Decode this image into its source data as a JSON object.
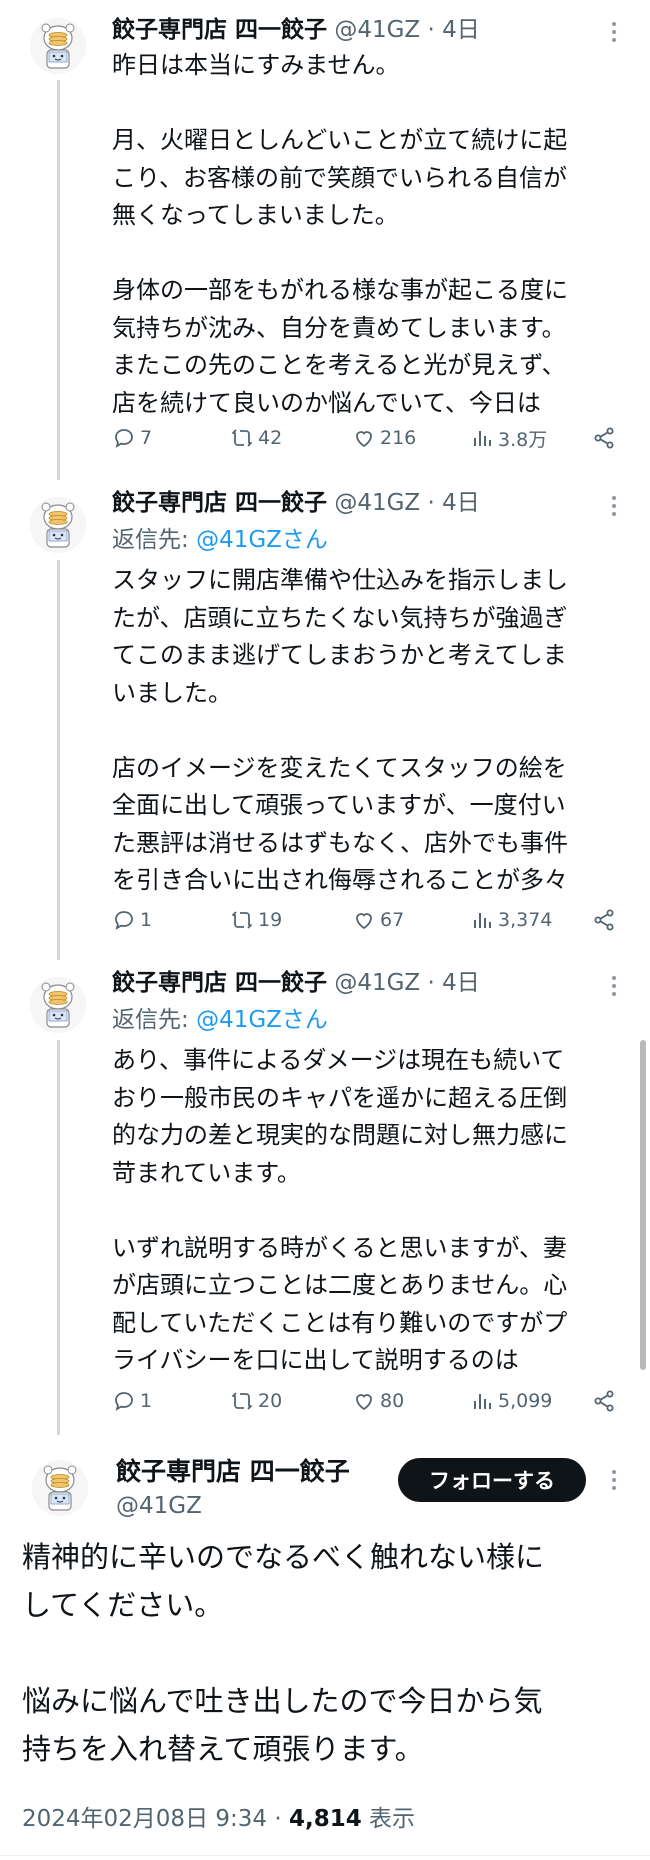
{
  "author": {
    "name": "餃子専門店 四一餃子",
    "handle": "@41GZ"
  },
  "thread": [
    {
      "name": "餃子専門店 四一餃子",
      "handle_time": "@41GZ · 4日",
      "reply_to": "",
      "mention": "",
      "text": "昨日は本当にすみません。\n\n月、火曜日としんどいことが立て続けに起\nこり、お客様の前で笑顔でいられる自信が\n無くなってしまいました。\n\n身体の一部をもがれる様な事が起こる度に\n気持ちが沈み、自分を責めてしまいます。\nまたこの先のことを考えると光が見えず、\n店を続けて良いのか悩んでいて、今日は",
      "replies": "7",
      "retweets": "42",
      "likes": "216",
      "views": "3.8万"
    },
    {
      "name": "餃子専門店 四一餃子",
      "handle_time": "@41GZ · 4日",
      "reply_to": "返信先: ",
      "mention": "@41GZさん",
      "text": "スタッフに開店準備や仕込みを指示しまし\nたが、店頭に立ちたくない気持ちが強過ぎ\nてこのまま逃げてしまおうかと考えてしま\nいました。\n\n店のイメージを変えたくてスタッフの絵を\n全面に出して頑張っていますが、一度付い\nた悪評は消せるはずもなく、店外でも事件\nを引き合いに出され侮辱されることが多々",
      "replies": "1",
      "retweets": "19",
      "likes": "67",
      "views": "3,374"
    },
    {
      "name": "餃子専門店 四一餃子",
      "handle_time": "@41GZ · 4日",
      "reply_to": "返信先: ",
      "mention": "@41GZさん",
      "text": "あり、事件によるダメージは現在も続いて\nおり一般市民のキャパを遥かに超える圧倒\n的な力の差と現実的な問題に対し無力感に\n苛まれています。\n\nいずれ説明する時がくると思いますが、妻\nが店頭に立つことは二度とありません。心\n配していただくことは有り難いのですがプ\nライバシーを口に出して説明するのは",
      "replies": "1",
      "retweets": "20",
      "likes": "80",
      "views": "5,099"
    }
  ],
  "main_tweet": {
    "follow_label": "フォローする",
    "text": "精神的に辛いのでなるべく触れない様に\nしてください。\n\n悩みに悩んで吐き出したので今日から気\n持ちを入れ替えて頑張ります。",
    "date": "2024年02月08日 9:34 · ",
    "view_count": "4,814",
    "view_label": " 表示"
  },
  "icons": {
    "reply": "reply-icon",
    "retweet": "retweet-icon",
    "like": "like-icon",
    "views": "views-icon",
    "share": "share-icon",
    "more": "more-icon"
  },
  "colors": {
    "link": "#1d9bf0",
    "secondary": "#536471",
    "follow_bg": "#0f1419"
  }
}
